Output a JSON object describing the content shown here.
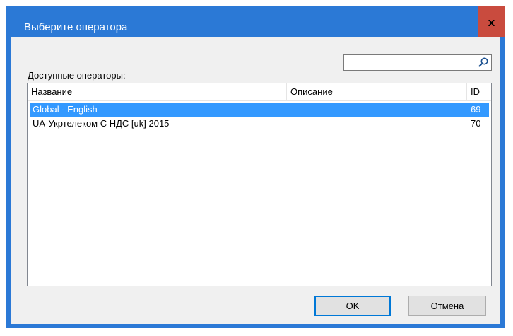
{
  "dialog": {
    "title": "Выберите оператора",
    "close_label": "x"
  },
  "available_label": "Доступные операторы:",
  "search": {
    "value": "",
    "placeholder": ""
  },
  "table": {
    "columns": [
      "Название",
      "Описание",
      "ID"
    ],
    "rows": [
      {
        "name": "Global - English",
        "description": "",
        "id": "69",
        "selected": true
      },
      {
        "name": "UA-Укртелеком С НДС [uk] 2015",
        "description": "",
        "id": "70",
        "selected": false
      }
    ]
  },
  "buttons": {
    "ok_label": "OK",
    "cancel_label": "Отмена"
  },
  "colors": {
    "titlebar": "#2b79d6",
    "close_button": "#c94b3e",
    "selection": "#3399ff",
    "client_background": "#f0f0f0",
    "default_button_border": "#0078d7"
  },
  "icons": {
    "search": "search-icon",
    "close": "close-icon"
  }
}
